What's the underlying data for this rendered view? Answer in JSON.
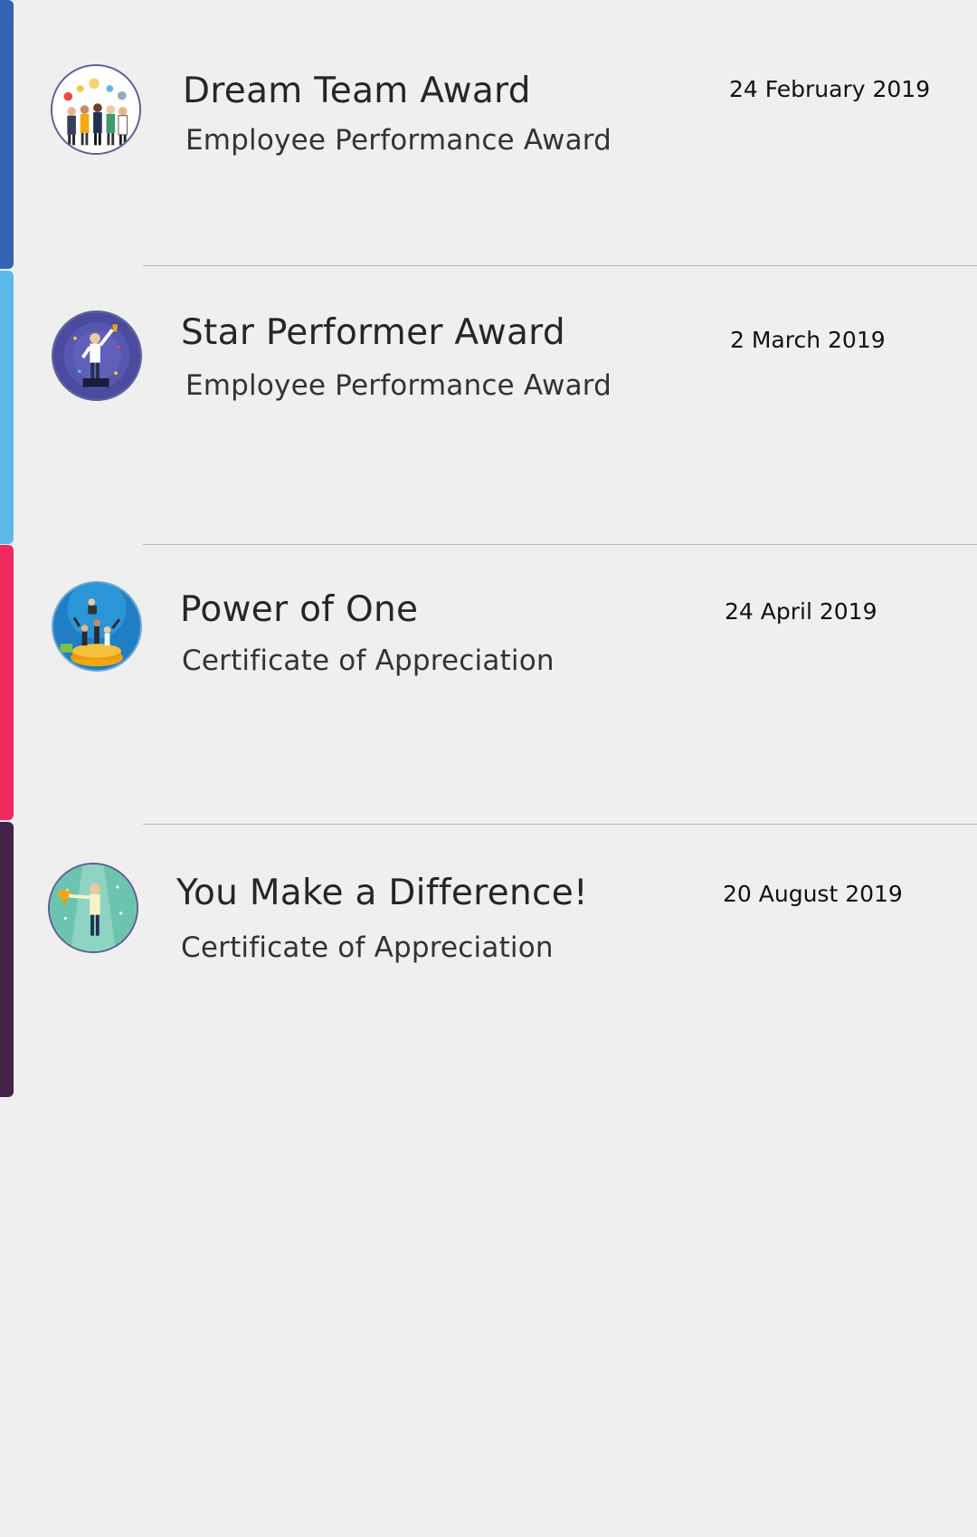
{
  "awards": [
    {
      "title": "Dream Team Award",
      "type": "Employee Performance Award",
      "date": "24 February 2019",
      "accent": "#3462b4",
      "icon": "team-illustration-icon"
    },
    {
      "title": "Star Performer Award",
      "type": "Employee Performance Award",
      "date": "2 March 2019",
      "accent": "#5db9e8",
      "icon": "star-performer-illustration-icon"
    },
    {
      "title": "Power of One",
      "type": "Certificate of Appreciation",
      "date": "24 April 2019",
      "accent": "#f1285e",
      "icon": "power-of-one-illustration-icon"
    },
    {
      "title": "You Make a Difference!",
      "type": "Certificate of Appreciation",
      "date": "20 August 2019",
      "accent": "#44224a",
      "icon": "trophy-winner-illustration-icon"
    }
  ]
}
